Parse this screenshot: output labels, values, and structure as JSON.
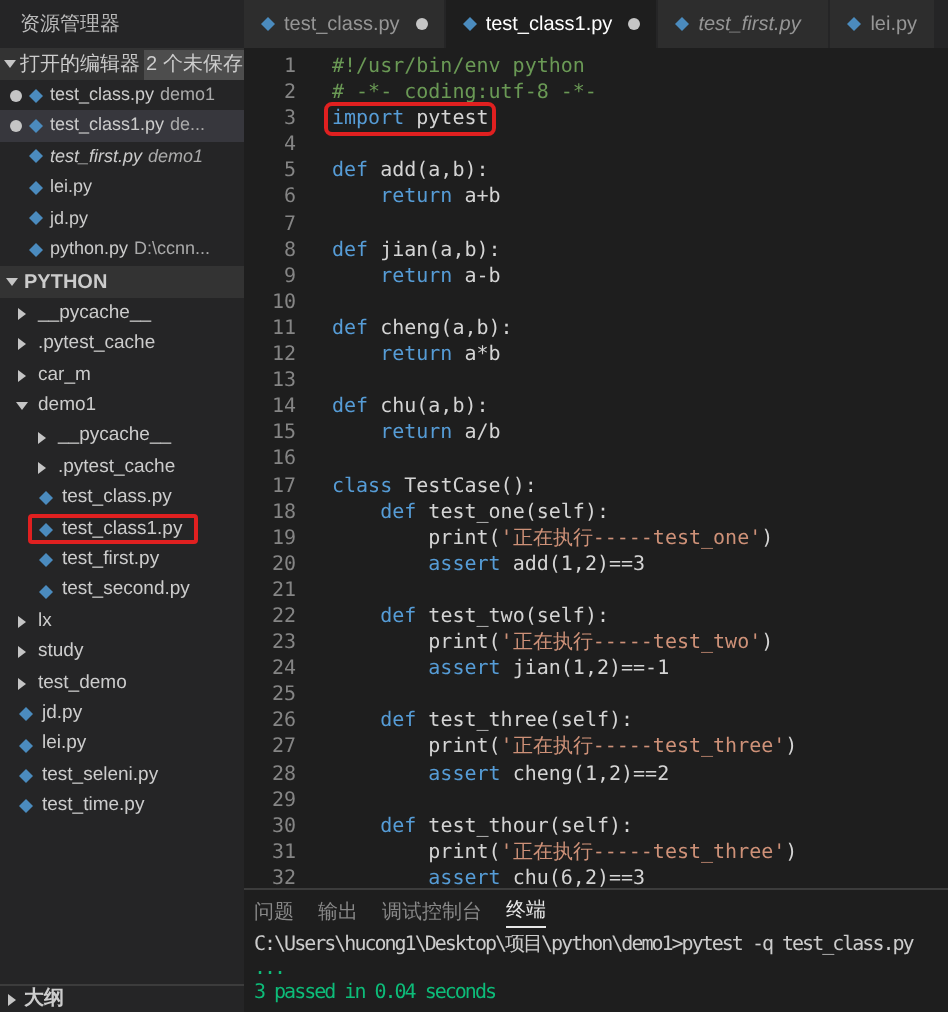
{
  "sidebar": {
    "title": "资源管理器",
    "open_editors": {
      "label": "打开的编辑器",
      "badge": "2 个未保存",
      "expanded": true,
      "items": [
        {
          "name": "test_class.py",
          "description": "demo1",
          "dirty": true,
          "preview": false,
          "selected": false
        },
        {
          "name": "test_class1.py",
          "description": "de...",
          "dirty": true,
          "preview": false,
          "selected": true
        },
        {
          "name": "test_first.py",
          "description": "demo1",
          "dirty": false,
          "preview": true,
          "selected": false
        },
        {
          "name": "lei.py",
          "dirty": false,
          "preview": false,
          "selected": false
        },
        {
          "name": "jd.py",
          "dirty": false,
          "preview": false,
          "selected": false
        },
        {
          "name": "python.py",
          "description": "D:\\ccnn...",
          "dirty": false,
          "preview": false,
          "selected": false
        }
      ]
    },
    "folder": {
      "label": "PYTHON",
      "expanded": true,
      "items": [
        {
          "kind": "folder",
          "name": "__pycache__",
          "expanded": false
        },
        {
          "kind": "folder",
          "name": ".pytest_cache",
          "expanded": false
        },
        {
          "kind": "folder",
          "name": "car_m",
          "expanded": false
        },
        {
          "kind": "folder",
          "name": "demo1",
          "expanded": true,
          "children": [
            {
              "kind": "folder",
              "name": "__pycache__",
              "expanded": false
            },
            {
              "kind": "folder",
              "name": ".pytest_cache",
              "expanded": false
            },
            {
              "kind": "file",
              "name": "test_class.py",
              "highlighted": false
            },
            {
              "kind": "file",
              "name": "test_class1.py",
              "highlighted": true
            },
            {
              "kind": "file",
              "name": "test_first.py",
              "highlighted": false
            },
            {
              "kind": "file",
              "name": "test_second.py",
              "highlighted": false
            }
          ]
        },
        {
          "kind": "folder",
          "name": "lx",
          "expanded": false
        },
        {
          "kind": "folder",
          "name": "study",
          "expanded": false
        },
        {
          "kind": "folder",
          "name": "test_demo",
          "expanded": false
        },
        {
          "kind": "file",
          "name": "jd.py",
          "highlighted": false
        },
        {
          "kind": "file",
          "name": "lei.py",
          "highlighted": false
        },
        {
          "kind": "file",
          "name": "test_seleni.py",
          "highlighted": false
        },
        {
          "kind": "file",
          "name": "test_time.py",
          "highlighted": false
        }
      ]
    },
    "outline": {
      "label": "大纲",
      "expanded": false
    }
  },
  "tabs": [
    {
      "label": "test_class.py",
      "dirty": true,
      "preview": false,
      "selected": false
    },
    {
      "label": "test_class1.py",
      "dirty": true,
      "preview": false,
      "selected": true
    },
    {
      "label": "test_first.py",
      "dirty": false,
      "preview": true,
      "selected": false
    },
    {
      "label": "lei.py",
      "dirty": false,
      "preview": false,
      "selected": false
    }
  ],
  "editor": {
    "lines": [
      {
        "number": "1",
        "tokens": [
          {
            "kind": "comment",
            "text": "#!/usr/bin/env python"
          }
        ]
      },
      {
        "number": "2",
        "tokens": [
          {
            "kind": "comment",
            "text": "# -*- coding:utf-8 -*-"
          }
        ]
      },
      {
        "number": "3",
        "highlighted": true,
        "tokens": [
          {
            "kind": "keyword",
            "text": "import"
          },
          {
            "kind": "plain",
            "text": " pytest"
          }
        ]
      },
      {
        "number": "4"
      },
      {
        "number": "5",
        "tokens": [
          {
            "kind": "keyword",
            "text": "def"
          },
          {
            "kind": "plain",
            "text": " add(a,b):"
          }
        ]
      },
      {
        "number": "6",
        "tokens": [
          {
            "kind": "keyword",
            "text": "    return"
          },
          {
            "kind": "plain",
            "text": " a+b"
          }
        ]
      },
      {
        "number": "7"
      },
      {
        "number": "8",
        "tokens": [
          {
            "kind": "keyword",
            "text": "def"
          },
          {
            "kind": "plain",
            "text": " jian(a,b):"
          }
        ]
      },
      {
        "number": "9",
        "tokens": [
          {
            "kind": "keyword",
            "text": "    return"
          },
          {
            "kind": "plain",
            "text": " a-b"
          }
        ]
      },
      {
        "number": "10"
      },
      {
        "number": "11",
        "tokens": [
          {
            "kind": "keyword",
            "text": "def"
          },
          {
            "kind": "plain",
            "text": " cheng(a,b):"
          }
        ]
      },
      {
        "number": "12",
        "tokens": [
          {
            "kind": "keyword",
            "text": "    return"
          },
          {
            "kind": "plain",
            "text": " a*b"
          }
        ]
      },
      {
        "number": "13"
      },
      {
        "number": "14",
        "tokens": [
          {
            "kind": "keyword",
            "text": "def"
          },
          {
            "kind": "plain",
            "text": " chu(a,b):"
          }
        ]
      },
      {
        "number": "15",
        "tokens": [
          {
            "kind": "keyword",
            "text": "    return"
          },
          {
            "kind": "plain",
            "text": " a/b"
          }
        ]
      },
      {
        "number": "16"
      },
      {
        "number": "17",
        "tokens": [
          {
            "kind": "keyword",
            "text": "class"
          },
          {
            "kind": "plain",
            "text": " TestCase():"
          }
        ]
      },
      {
        "number": "18",
        "tokens": [
          {
            "kind": "keyword",
            "text": "    def"
          },
          {
            "kind": "plain",
            "text": " test_one(self):"
          }
        ]
      },
      {
        "number": "19",
        "tokens": [
          {
            "kind": "plain",
            "text": "        print("
          },
          {
            "kind": "string",
            "text": "'正在执行-----test_one'"
          },
          {
            "kind": "plain",
            "text": ")"
          }
        ]
      },
      {
        "number": "20",
        "tokens": [
          {
            "kind": "keyword",
            "text": "        assert"
          },
          {
            "kind": "plain",
            "text": " add(1,2)==3"
          }
        ]
      },
      {
        "number": "21"
      },
      {
        "number": "22",
        "tokens": [
          {
            "kind": "keyword",
            "text": "    def"
          },
          {
            "kind": "plain",
            "text": " test_two(self):"
          }
        ]
      },
      {
        "number": "23",
        "tokens": [
          {
            "kind": "plain",
            "text": "        print("
          },
          {
            "kind": "string",
            "text": "'正在执行-----test_two'"
          },
          {
            "kind": "plain",
            "text": ")"
          }
        ]
      },
      {
        "number": "24",
        "tokens": [
          {
            "kind": "keyword",
            "text": "        assert"
          },
          {
            "kind": "plain",
            "text": " jian(1,2)==-1"
          }
        ]
      },
      {
        "number": "25"
      },
      {
        "number": "26",
        "tokens": [
          {
            "kind": "keyword",
            "text": "    def"
          },
          {
            "kind": "plain",
            "text": " test_three(self):"
          }
        ]
      },
      {
        "number": "27",
        "tokens": [
          {
            "kind": "plain",
            "text": "        print("
          },
          {
            "kind": "string",
            "text": "'正在执行-----test_three'"
          },
          {
            "kind": "plain",
            "text": ")"
          }
        ]
      },
      {
        "number": "28",
        "tokens": [
          {
            "kind": "keyword",
            "text": "        assert"
          },
          {
            "kind": "plain",
            "text": " cheng(1,2)==2"
          }
        ]
      },
      {
        "number": "29"
      },
      {
        "number": "30",
        "tokens": [
          {
            "kind": "keyword",
            "text": "    def"
          },
          {
            "kind": "plain",
            "text": " test_thour(self):"
          }
        ]
      },
      {
        "number": "31",
        "tokens": [
          {
            "kind": "plain",
            "text": "        print("
          },
          {
            "kind": "string",
            "text": "'正在执行-----test_three'"
          },
          {
            "kind": "plain",
            "text": ")"
          }
        ]
      },
      {
        "number": "32",
        "tokens": [
          {
            "kind": "keyword",
            "text": "        assert"
          },
          {
            "kind": "plain",
            "text": " chu(6,2)==3"
          }
        ]
      }
    ]
  },
  "panel": {
    "tabs": [
      {
        "label": "问题",
        "selected": false
      },
      {
        "label": "输出",
        "selected": false
      },
      {
        "label": "调试控制台",
        "selected": false
      },
      {
        "label": "终端",
        "selected": true
      }
    ],
    "terminal": [
      {
        "kind": "command",
        "text": "C:\\Users\\hucong1\\Desktop\\项目\\python\\demo1>pytest -q test_class.py"
      },
      {
        "kind": "success",
        "text": "..."
      },
      {
        "kind": "success",
        "text": "3 passed in 0.04 seconds"
      }
    ]
  }
}
